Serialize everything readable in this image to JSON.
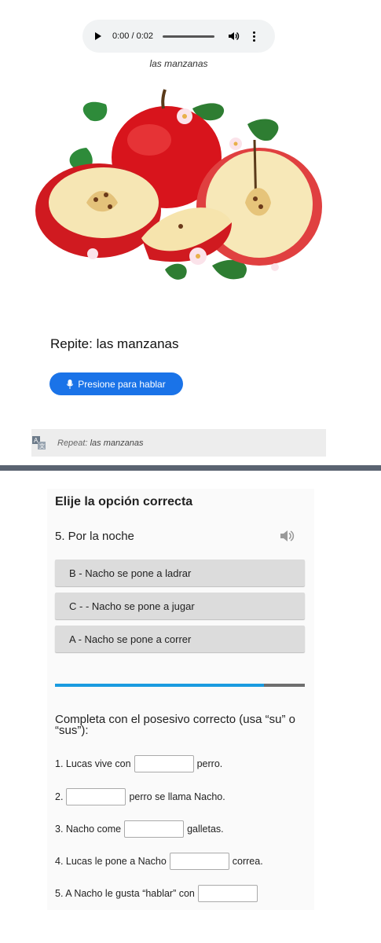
{
  "audio": {
    "time": "0:00 / 0:02"
  },
  "caption": "las manzanas",
  "repite": "Repite: las manzanas",
  "speak_button": "Presione para hablar",
  "translation": {
    "label": "Repeat:",
    "text": "las manzanas"
  },
  "quiz": {
    "title": "Elije la opción correcta",
    "question": "5. Por la noche",
    "options": [
      "B - Nacho se pone a ladrar",
      "C -  - Nacho se pone a jugar",
      "A - Nacho se pone a correr"
    ]
  },
  "exercise": {
    "instructions": "Completa con el posesivo correcto (usa “su” o “sus”):",
    "lines": [
      {
        "before": "1. Lucas vive con",
        "after": "perro."
      },
      {
        "before": "2.",
        "after": "perro se llama Nacho."
      },
      {
        "before": "3. Nacho come",
        "after": "galletas."
      },
      {
        "before": "4. Lucas le pone a Nacho",
        "after": "correa."
      },
      {
        "before": "5. A Nacho le gusta “hablar” con",
        "after": ""
      }
    ]
  },
  "colors": {
    "accent": "#1a73e8",
    "progress": "#1a9be0",
    "divider": "#5a6371"
  },
  "icons": [
    "play-icon",
    "volume-icon",
    "more-vert-icon",
    "microphone-icon",
    "translate-icon",
    "speaker-icon"
  ]
}
